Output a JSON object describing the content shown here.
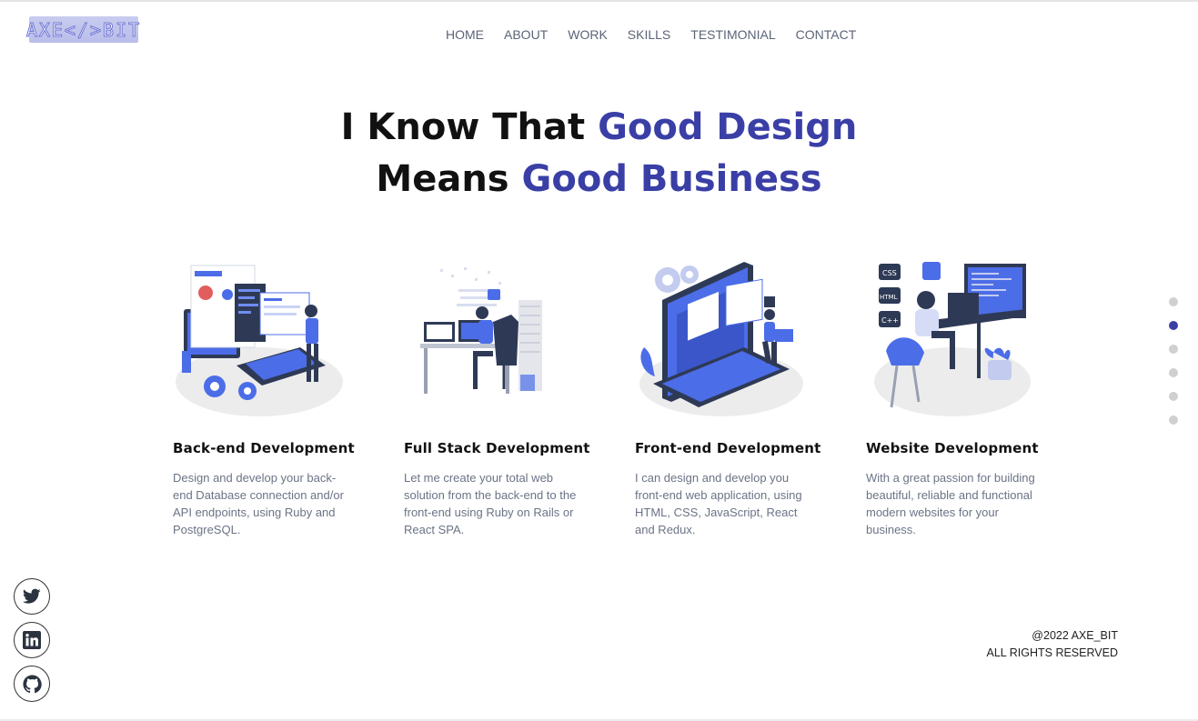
{
  "logo": {
    "text": "AXE</>BIT"
  },
  "nav": {
    "items": [
      "HOME",
      "ABOUT",
      "WORK",
      "SKILLS",
      "TESTIMONIAL",
      "CONTACT"
    ]
  },
  "hero": {
    "line1_plain": "I Know That ",
    "line1_accent": "Good Design",
    "line2_plain": "Means ",
    "line2_accent": "Good Business"
  },
  "services": [
    {
      "title": "Back-end Development",
      "description": "Design and develop your back-end Database connection and/or API endpoints, using Ruby and PostgreSQL.",
      "icon": "backend-illustration"
    },
    {
      "title": "Full Stack Development",
      "description": "Let me create your total web solution from the back-end to the front-end using Ruby on Rails or React SPA.",
      "icon": "fullstack-illustration"
    },
    {
      "title": "Front-end Development",
      "description": "I can design and develop you front-end web application, using HTML, CSS, JavaScript, React and Redux.",
      "icon": "frontend-illustration"
    },
    {
      "title": "Website Development",
      "description": "With a great passion for building beautiful, reliable and functional modern websites for your business.",
      "icon": "website-illustration"
    }
  ],
  "section_dots": {
    "count": 6,
    "active_index": 1
  },
  "social": [
    "twitter-icon",
    "linkedin-icon",
    "github-icon"
  ],
  "footer": {
    "line1": "@2022 AXE_BIT",
    "line2": "ALL RIGHTS RESERVED"
  },
  "colors": {
    "accent": "#3a3fa6",
    "muted_text": "#6b7386",
    "nav_text": "#5b6477",
    "illustration_blue": "#4c6de8"
  }
}
